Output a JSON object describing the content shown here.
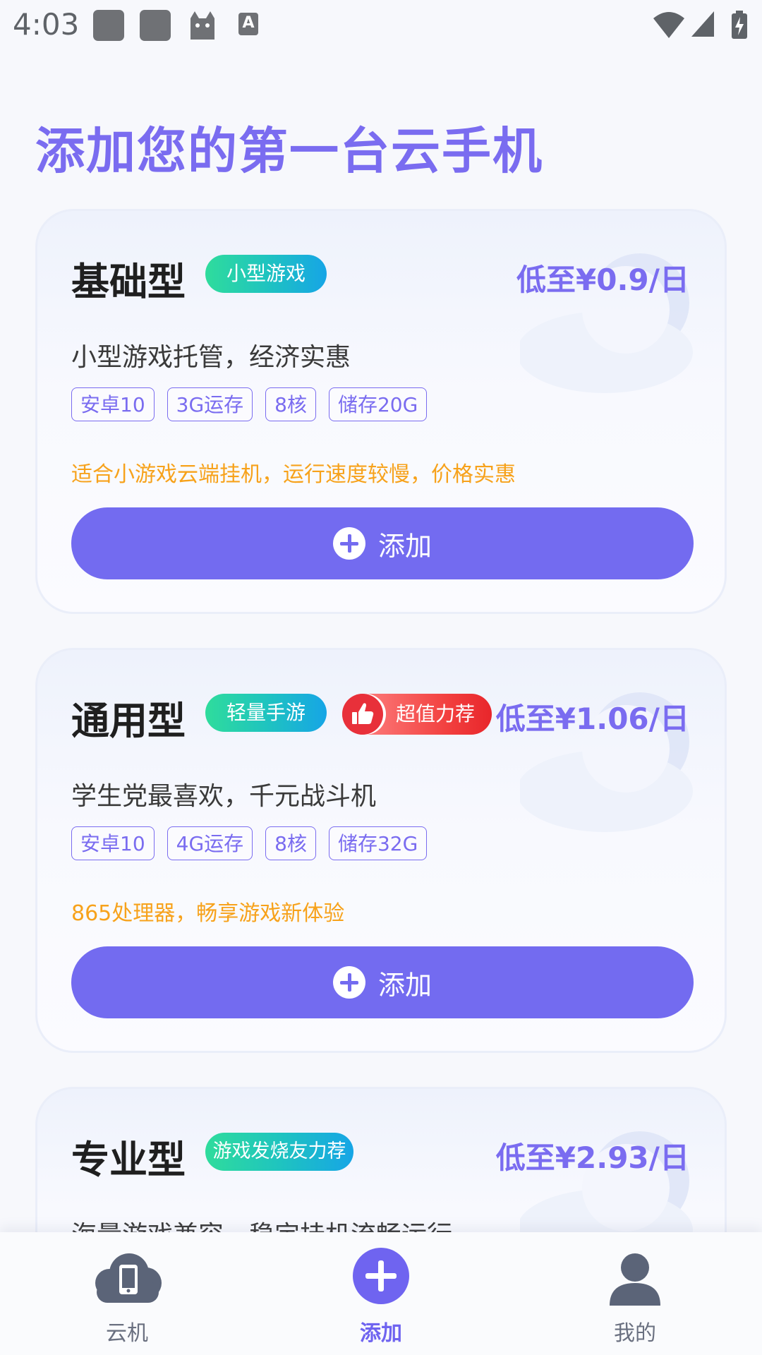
{
  "status_bar": {
    "time": "4:03"
  },
  "page": {
    "title": "添加您的第一台云手机"
  },
  "plans": [
    {
      "name": "基础型",
      "tag": "小型游戏",
      "price": "低至¥0.9/日",
      "desc": "小型游戏托管，经济实惠",
      "specs": [
        "安卓10",
        "3G运存",
        "8核",
        "储存20G"
      ],
      "note": "适合小游戏云端挂机，运行速度较慢，价格实惠",
      "button": "添加"
    },
    {
      "name": "通用型",
      "tag": "轻量手游",
      "hot_badge": "超值力荐",
      "price": "低至¥1.06/日",
      "desc": "学生党最喜欢，千元战斗机",
      "specs": [
        "安卓10",
        "4G运存",
        "8核",
        "储存32G"
      ],
      "note": "865处理器，畅享游戏新体验",
      "button": "添加"
    },
    {
      "name": "专业型",
      "tag": "游戏发烧友力荐",
      "price": "低至¥2.93/日",
      "desc": "海量游戏兼容，稳定挂机流畅运行"
    }
  ],
  "tabbar": {
    "items": [
      {
        "label": "云机",
        "icon": "cloud-phone-icon"
      },
      {
        "label": "添加",
        "icon": "plus-circle-icon",
        "active": true
      },
      {
        "label": "我的",
        "icon": "user-icon"
      }
    ]
  },
  "colors": {
    "accent": "#736bf0",
    "note": "#f7a21b",
    "title": "#7a6cf0"
  }
}
